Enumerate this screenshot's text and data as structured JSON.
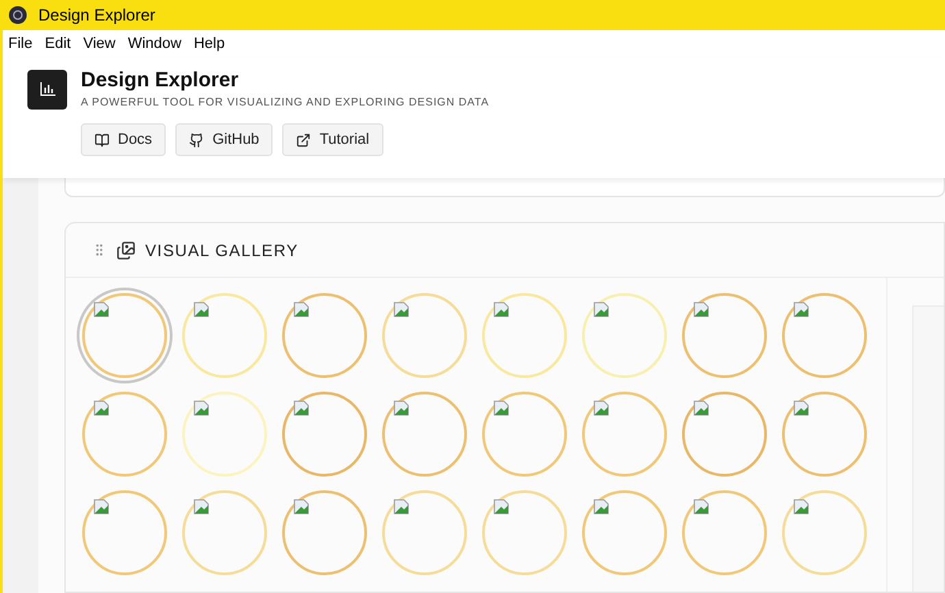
{
  "window": {
    "title": "Design Explorer"
  },
  "menu": [
    "File",
    "Edit",
    "View",
    "Window",
    "Help"
  ],
  "header": {
    "title": "Design Explorer",
    "subtitle": "A POWERFUL TOOL FOR VISUALIZING AND EXPLORING DESIGN DATA",
    "buttons": [
      {
        "label": "Docs",
        "kind": "book"
      },
      {
        "label": "GitHub",
        "kind": "github"
      },
      {
        "label": "Tutorial",
        "kind": "external"
      }
    ]
  },
  "gallery": {
    "title": "VISUAL GALLERY",
    "items": [
      {
        "color": "#f0c878",
        "selected": true
      },
      {
        "color": "#f8e8a0",
        "selected": false
      },
      {
        "color": "#ecc070",
        "selected": false
      },
      {
        "color": "#f5dc98",
        "selected": false
      },
      {
        "color": "#f8e8a0",
        "selected": false
      },
      {
        "color": "#f8f0b0",
        "selected": false
      },
      {
        "color": "#ecc070",
        "selected": false
      },
      {
        "color": "#ecc070",
        "selected": false
      },
      {
        "color": "#f0c878",
        "selected": false
      },
      {
        "color": "#fbf3c0",
        "selected": false
      },
      {
        "color": "#e8b868",
        "selected": false
      },
      {
        "color": "#ecc070",
        "selected": false
      },
      {
        "color": "#f0c878",
        "selected": false
      },
      {
        "color": "#f0c878",
        "selected": false
      },
      {
        "color": "#e8b868",
        "selected": false
      },
      {
        "color": "#ecc070",
        "selected": false
      },
      {
        "color": "#f0c878",
        "selected": false
      },
      {
        "color": "#f5dc98",
        "selected": false
      },
      {
        "color": "#ecc070",
        "selected": false
      },
      {
        "color": "#f5dc98",
        "selected": false
      },
      {
        "color": "#f5dc98",
        "selected": false
      },
      {
        "color": "#f0c878",
        "selected": false
      },
      {
        "color": "#f0c878",
        "selected": false
      },
      {
        "color": "#f5dc98",
        "selected": false
      }
    ]
  }
}
